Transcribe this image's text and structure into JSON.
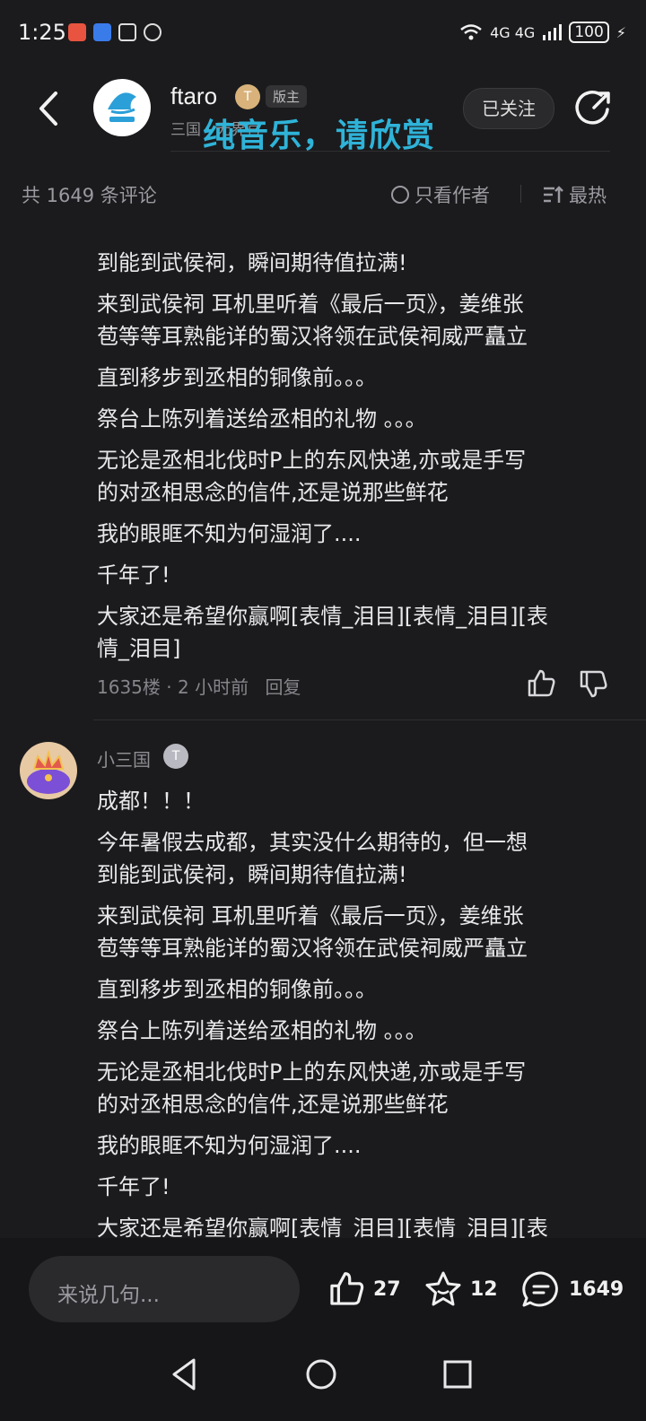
{
  "status_bar": {
    "time": "1:25",
    "network": "4G 4G",
    "battery": "100"
  },
  "header": {
    "author_name": "ftaro",
    "role_badge": "版主",
    "subtitle": "三国  ·  无界官",
    "overlay_title": "纯音乐，请欣赏",
    "follow_label": "已关注"
  },
  "filter_bar": {
    "count": "共 1649 条评论",
    "author_only": "只看作者",
    "sort": "最热"
  },
  "comments": [
    {
      "lines": [
        "到能到武侯祠，瞬间期待值拉满!",
        "来到武侯祠 耳机里听着《最后一页》，姜维张",
        "苞等等耳熟能详的蜀汉将领在武侯祠威严矗立",
        "直到移步到丞相的铜像前。。。",
        "祭台上陈列着送给丞相的礼物 。。。",
        "无论是丞相北伐时P上的东风快递,亦或是手写",
        "的对丞相思念的信件,还是说那些鲜花",
        "我的眼眶不知为何湿润了....",
        "千年了!",
        "大家还是希望你赢啊[表情_泪目][表情_泪目][表",
        "情_泪目]"
      ],
      "floor": "1635楼",
      "time": "2 小时前",
      "reply": "回复"
    },
    {
      "name": "小三国",
      "lines": [
        "成都！！！",
        "今年暑假去成都，其实没什么期待的，但一想",
        "到能到武侯祠，瞬间期待值拉满!",
        "来到武侯祠 耳机里听着《最后一页》，姜维张",
        "苞等等耳熟能详的蜀汉将领在武侯祠威严矗立",
        "直到移步到丞相的铜像前。。。",
        "祭台上陈列着送给丞相的礼物 。。。",
        "无论是丞相北伐时P上的东风快递,亦或是手写",
        "的对丞相思念的信件,还是说那些鲜花",
        "我的眼眶不知为何湿润了....",
        "千年了!",
        "大家还是希望你赢啊[表情_泪目][表情_泪目][表"
      ]
    }
  ],
  "bottom_bar": {
    "input_placeholder": "来说几句...",
    "likes": "27",
    "favorites": "12",
    "comments": "1649"
  },
  "colors": {
    "background": "#1b1b1d",
    "overlay_title": "#2fb3d8",
    "text": "#e8e8ea",
    "muted": "#85858b"
  }
}
